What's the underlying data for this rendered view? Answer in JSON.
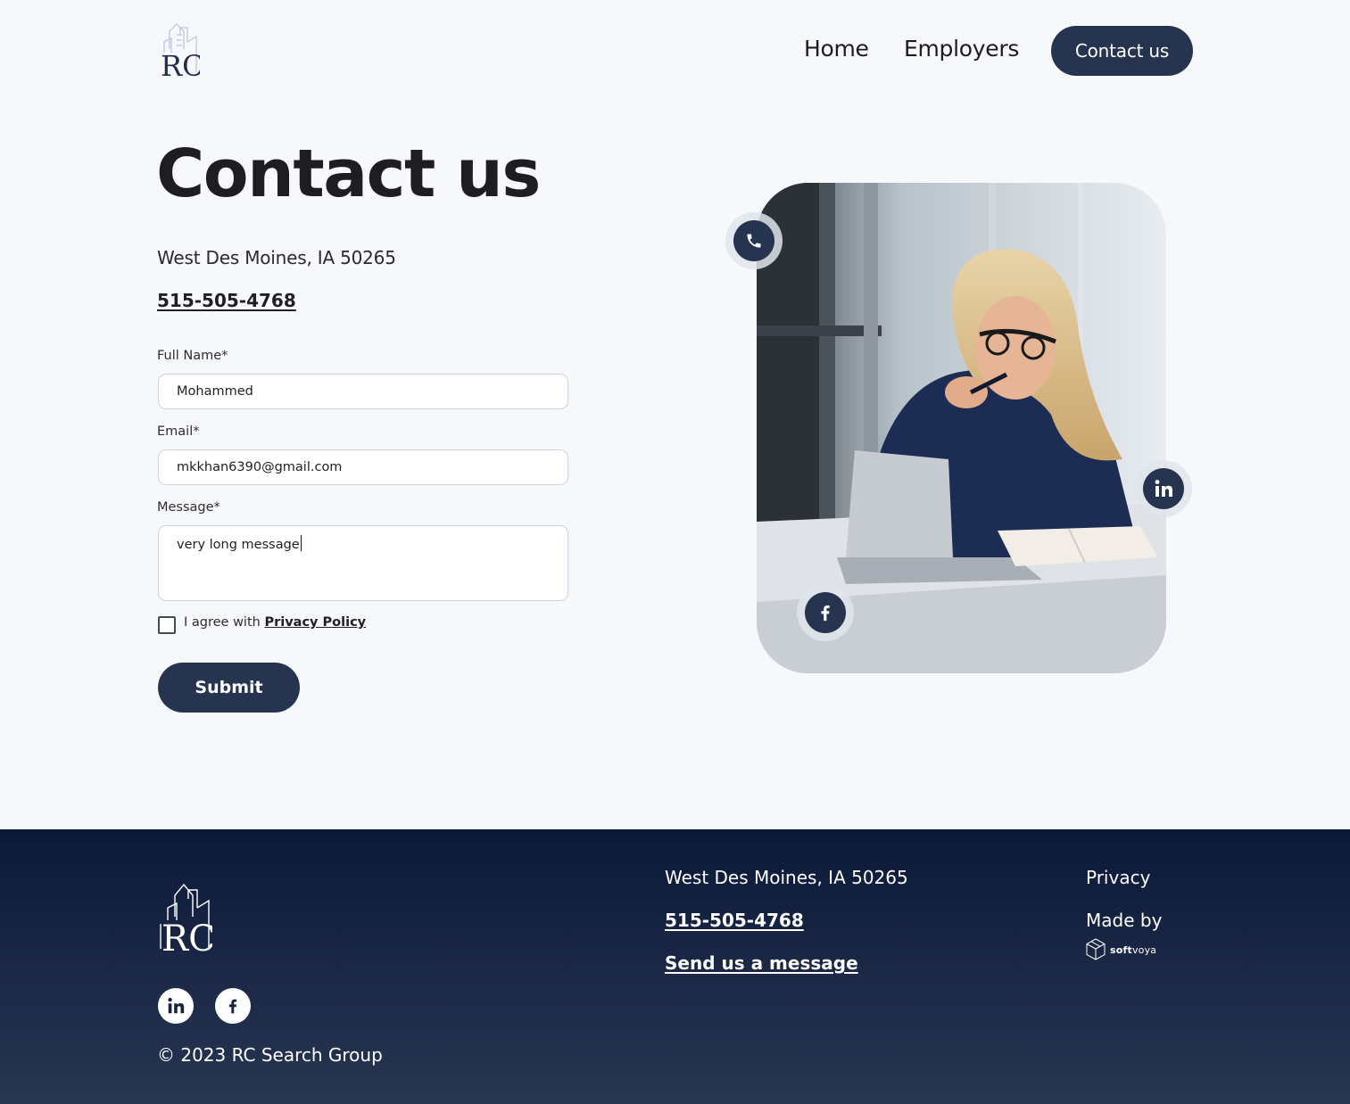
{
  "header": {
    "logo_text": "RC",
    "nav": {
      "home": "Home",
      "employers": "Employers",
      "contact": "Contact us"
    }
  },
  "main": {
    "title": "Contact us",
    "address": "West Des Moines, IA 50265",
    "phone": "515-505-4768",
    "form": {
      "full_name_label": "Full Name*",
      "full_name_value": "Mohammed",
      "email_label": "Email*",
      "email_value": "mkkhan6390@gmail.com",
      "message_label": "Message*",
      "message_value": "very long message",
      "agree_text": "I agree with ",
      "privacy_link": "Privacy Policy",
      "submit": "Submit"
    },
    "floating_icons": [
      "phone-icon",
      "linkedin-icon",
      "facebook-icon"
    ]
  },
  "footer": {
    "logo_text": "RC",
    "social": [
      "linkedin-icon",
      "facebook-icon"
    ],
    "copyright": "© 2023 RC Search Group",
    "address": "West Des Moines, IA 50265",
    "phone": "515-505-4768",
    "send_message": "Send us a message",
    "privacy": "Privacy",
    "made_by": "Made by",
    "brand_bold": "soft",
    "brand_rest": "voya"
  },
  "colors": {
    "page_background": "#f6f8fc",
    "accent_navy": "#27344f",
    "footer_top": "#0c1838",
    "footer_bottom": "#283652"
  }
}
